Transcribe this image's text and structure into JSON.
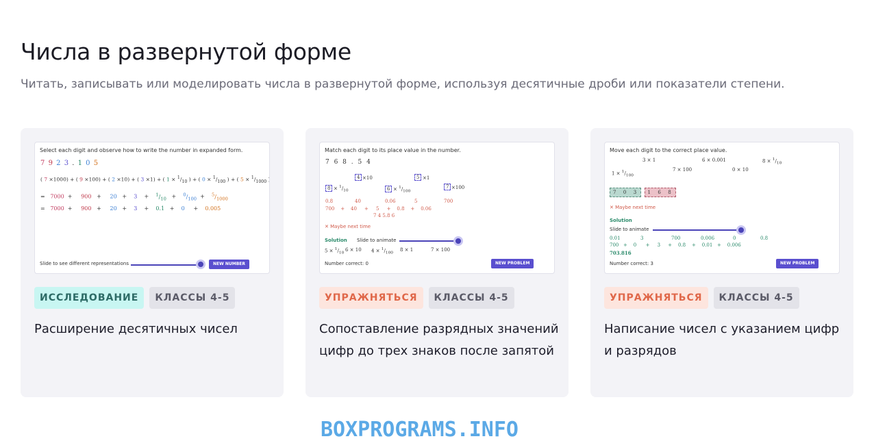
{
  "page": {
    "title": "Числа в развернутой форме",
    "subtitle": "Читать, записывать или моделировать числа в развернутой форме, используя десятичные дроби или показатели степени."
  },
  "cards": [
    {
      "tags": [
        "ИССЛЕДОВАНИЕ",
        "КЛАССЫ 4-5"
      ],
      "title": "Расширение десятичных чисел",
      "thumb": {
        "instruction": "Select each digit and observe how to write the number in expanded form.",
        "number": "7 9 2 3 . 1 0 5",
        "expr": "( 7 ×1000) + ( 9 ×100) + ( 2 ×10) + ( 3 ×1) + ( 1 × 1/10 ) + ( 0 × 1/100 ) + ( 5 × 1/1000 )",
        "row1": [
          "=",
          "7000",
          "+",
          "900",
          "+",
          "20",
          "+",
          "3",
          "+",
          "1/10",
          "+",
          "0/100",
          "+",
          "5/1000"
        ],
        "row2": [
          "=",
          "7000",
          "+",
          "900",
          "+",
          "20",
          "+",
          "3",
          "+",
          "0.1",
          "+",
          "0",
          "+",
          "0.005"
        ],
        "slider_label": "Slide to see different representations",
        "button": "NEW NUMBER"
      }
    },
    {
      "tags": [
        "УПРАЖНЯТЬСЯ",
        "КЛАССЫ 4-5"
      ],
      "title": "Сопоставление разрядных значений цифр до трех знаков после запятой",
      "thumb": {
        "instruction": "Match each digit to its place value in the number.",
        "number": "7 6 8 . 5 4",
        "digits": [
          "8",
          "4",
          "6",
          "5",
          "7"
        ],
        "factors": [
          "× 1/10",
          "×10",
          "× 1/100",
          "×1",
          "×100"
        ],
        "row1": [
          "0.8",
          "40",
          "0.06",
          "5",
          "700"
        ],
        "row2": [
          "700",
          "+",
          "40",
          "+",
          "5",
          "+",
          "0.8",
          "+",
          "0.06"
        ],
        "answer_digits": "7 4 5.8 6",
        "feedback": "✕ Maybe next time",
        "solution_label": "Solution",
        "slide_label": "Slide to animate",
        "solution_terms": [
          "5 × 1/10",
          "6 × 10",
          "4 × 1/100",
          "8 × 1",
          "7 × 100"
        ],
        "score": "Number correct: 0",
        "button": "NEW PROBLEM"
      }
    },
    {
      "tags": [
        "УПРАЖНЯТЬСЯ",
        "КЛАССЫ 4-5"
      ],
      "title": "Написание чисел с указанием цифр и разрядов",
      "thumb": {
        "instruction": "Move each digit to the correct place value.",
        "terms_top": [
          "3 × 1",
          "6 × 0.001",
          "8 × 1/10"
        ],
        "terms_mid": [
          "1 × 1/100",
          "7 × 100",
          "0 × 10"
        ],
        "tiles_green": [
          "7",
          "0",
          "3"
        ],
        "tiles_red": [
          "1",
          "6",
          "8"
        ],
        "feedback": "✕ Maybe next time",
        "solution_label": "Solution",
        "slide_label": "Slide to animate",
        "sol_row1": [
          "0.01",
          "3",
          "700",
          "0.006",
          "0",
          "0.8"
        ],
        "sol_row2": [
          "700",
          "+",
          "0",
          "+",
          "3",
          "+",
          "0.8",
          "+",
          "0.01",
          "+",
          "0.006"
        ],
        "answer": "703.816",
        "score": "Number correct: 3",
        "button": "NEW PROBLEM"
      }
    }
  ],
  "watermark": "BOXPROGRAMS.INFO",
  "colors": {
    "accent": "#5a4fcf",
    "card_bg": "#f3f3f7",
    "tag_explore_bg": "#c8f6f2",
    "tag_practice_bg": "#fde5de",
    "tag_grade_bg": "#e3e3e9"
  }
}
